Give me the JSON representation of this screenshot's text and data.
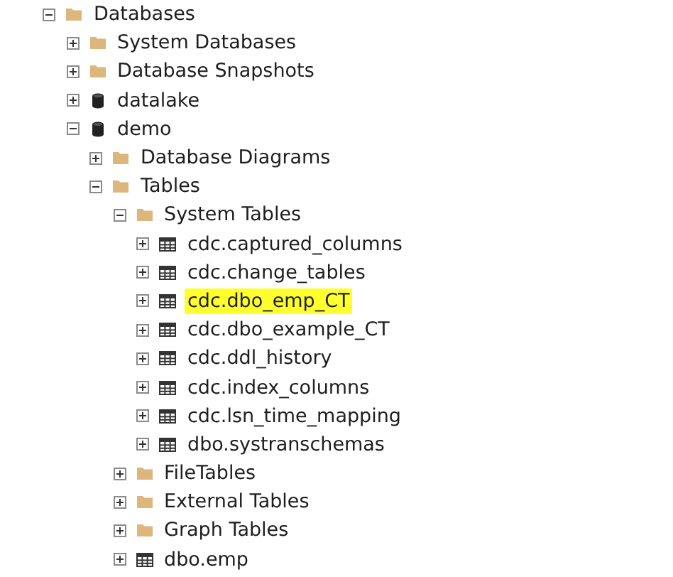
{
  "tree": [
    {
      "label": "Databases",
      "kind": "folder",
      "expanded": true,
      "selected": false,
      "children": [
        {
          "label": "System Databases",
          "kind": "folder",
          "expanded": false,
          "selected": false
        },
        {
          "label": "Database Snapshots",
          "kind": "folder",
          "expanded": false,
          "selected": false
        },
        {
          "label": "datalake",
          "kind": "database",
          "expanded": false,
          "selected": false
        },
        {
          "label": "demo",
          "kind": "database",
          "expanded": true,
          "selected": false,
          "children": [
            {
              "label": "Database Diagrams",
              "kind": "folder",
              "expanded": false,
              "selected": false
            },
            {
              "label": "Tables",
              "kind": "folder",
              "expanded": true,
              "selected": false,
              "children": [
                {
                  "label": "System Tables",
                  "kind": "folder",
                  "expanded": true,
                  "selected": false,
                  "children": [
                    {
                      "label": "cdc.captured_columns",
                      "kind": "table",
                      "expanded": false,
                      "selected": false
                    },
                    {
                      "label": "cdc.change_tables",
                      "kind": "table",
                      "expanded": false,
                      "selected": false
                    },
                    {
                      "label": "cdc.dbo_emp_CT",
                      "kind": "table",
                      "expanded": false,
                      "selected": true
                    },
                    {
                      "label": "cdc.dbo_example_CT",
                      "kind": "table",
                      "expanded": false,
                      "selected": false
                    },
                    {
                      "label": "cdc.ddl_history",
                      "kind": "table",
                      "expanded": false,
                      "selected": false
                    },
                    {
                      "label": "cdc.index_columns",
                      "kind": "table",
                      "expanded": false,
                      "selected": false
                    },
                    {
                      "label": "cdc.lsn_time_mapping",
                      "kind": "table",
                      "expanded": false,
                      "selected": false
                    },
                    {
                      "label": "dbo.systranschemas",
                      "kind": "table",
                      "expanded": false,
                      "selected": false
                    }
                  ]
                },
                {
                  "label": "FileTables",
                  "kind": "folder",
                  "expanded": false,
                  "selected": false
                },
                {
                  "label": "External Tables",
                  "kind": "folder",
                  "expanded": false,
                  "selected": false
                },
                {
                  "label": "Graph Tables",
                  "kind": "folder",
                  "expanded": false,
                  "selected": false
                },
                {
                  "label": "dbo.emp",
                  "kind": "table",
                  "expanded": false,
                  "selected": false
                }
              ]
            }
          ]
        }
      ]
    }
  ]
}
